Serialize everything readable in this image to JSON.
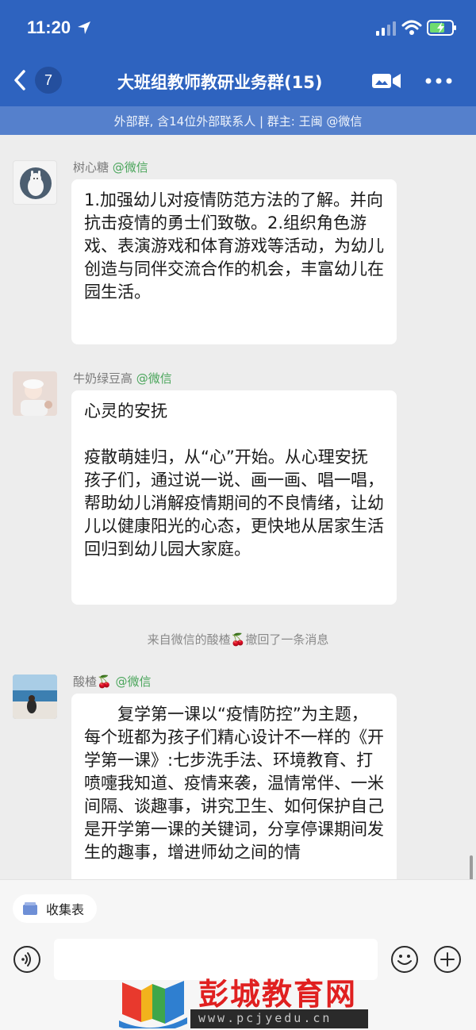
{
  "status": {
    "time": "11:20"
  },
  "nav": {
    "unread_count": "7",
    "title": "大班组教师教研业务群(15)",
    "subtitle": "外部群, 含14位外部联系人 | 群主: 王闽 @微信"
  },
  "messages": [
    {
      "sender": "树心糖",
      "tag": "@微信",
      "paragraphs": [
        "1.加强幼儿对疫情防范方法的了解。并向抗击疫情的勇士们致敬。2.组织角色游戏、表演游戏和体育游戏等活动，为幼儿创造与同伴交流合作的机会，丰富幼儿在园生活。"
      ]
    },
    {
      "sender": "牛奶绿豆高",
      "tag": "@微信",
      "paragraphs": [
        "心灵的安抚",
        "疫散萌娃归，从“心”开始。从心理安抚孩子们，通过说一说、画一画、唱一唱，帮助幼儿消解疫情期间的不良情绪，让幼儿以健康阳光的心态，更快地从居家生活回归到幼儿园大家庭。"
      ]
    },
    {
      "sender": "酸楂🍒",
      "tag": "@微信",
      "paragraphs": [
        "复学第一课以“疫情防控”为主题，每个班都为孩子们精心设计不一样的《开学第一课》:七步洗手法、环境教育、打喷嚏我知道、疫情来袭，温情常伴、一米间隔、谈趣事，讲究卫生、如何保护自己是开学第一课的关键词，分享停课期间发生的趣事，增进师幼之间的情"
      ]
    }
  ],
  "system_message": "来自微信的酸楂🍒撤回了一条消息",
  "bottom": {
    "chip_label": "收集表",
    "input_value": ""
  },
  "watermark": {
    "title": "彭城教育网",
    "url": "www.pcjyedu.cn"
  },
  "colors": {
    "header": "#2e63bf",
    "subbar": "#5580cc",
    "background": "#ededed",
    "tag_green": "#4aa55b",
    "watermark_red": "#e02020"
  },
  "icons": [
    "location-arrow-icon",
    "signal-icon",
    "wifi-icon",
    "battery-charging-icon",
    "back-chevron-icon",
    "video-call-icon",
    "more-icon",
    "collect-form-icon",
    "voice-icon",
    "emoji-icon",
    "plus-icon"
  ]
}
